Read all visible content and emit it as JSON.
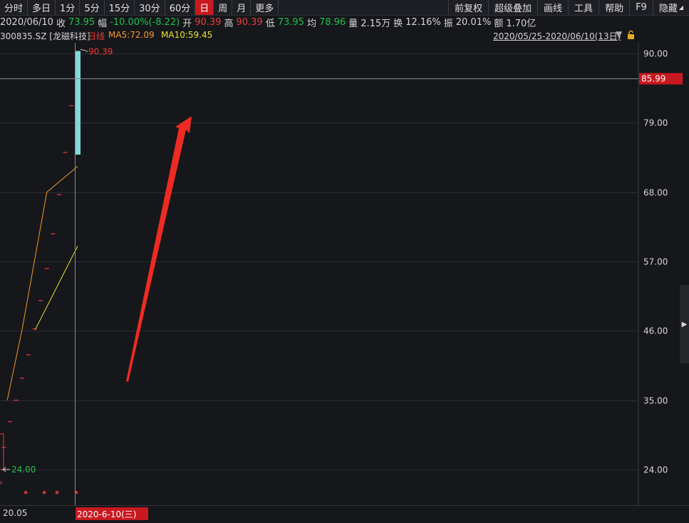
{
  "toolbar": {
    "left": [
      "分时",
      "多日",
      "1分",
      "5分",
      "15分",
      "30分",
      "60分",
      "日",
      "周",
      "月",
      "更多"
    ],
    "active": "日",
    "right": [
      "前复权",
      "超级叠加",
      "画线",
      "工具",
      "帮助",
      "F9",
      "隐藏"
    ]
  },
  "quote": {
    "date": "2020/06/10",
    "close_label": "收",
    "close": "73.95",
    "amp_label": "幅",
    "change_pct": "-10.00%",
    "change_val": "(-8.22)",
    "open_label": "开",
    "open": "90.39",
    "high_label": "高",
    "high": "90.39",
    "low_label": "低",
    "low": "73.95",
    "avg_label": "均",
    "avg": "78.96",
    "vol_label": "量",
    "vol": "2.15万",
    "turnover_label": "换",
    "turnover": "12.16%",
    "swing_label": "振",
    "swing": "20.01%",
    "amount_label": "额",
    "amount": "1.70亿"
  },
  "info": {
    "code": "300835.SZ [龙磁科技]",
    "period": "日线",
    "ma5": "MA5:72.09",
    "ma10": "MA10:59.45",
    "range": "2020/05/25-2020/06/10(13日)"
  },
  "colors": {
    "up": "#ef3a3a",
    "down": "#1fbf4e",
    "ma5": "#f29a2e",
    "ma10": "#e9e432",
    "candle_down_fill": "#7fd9dc",
    "badge": "#c7191f",
    "grid": "#2c2d33",
    "arrow": "#ee2b22"
  },
  "chart_data": {
    "type": "candlestick",
    "y_axis": {
      "ticks": [
        90.0,
        79.0,
        68.0,
        57.0,
        46.0,
        35.0,
        24.0
      ],
      "range": [
        24.0,
        90.0
      ]
    },
    "y_tick_labels": [
      "90.00",
      "79.00",
      "68.00",
      "57.00",
      "46.00",
      "35.00",
      "24.00"
    ],
    "crosshair_price": 85.99,
    "crosshair_label": "85.99",
    "high_label": "90.39",
    "low_label": "24.00",
    "x_labels": {
      "left": "20.05",
      "current": "2020-6-10(三)"
    },
    "candle_last": {
      "open": 90.39,
      "high": 90.39,
      "low": 73.95,
      "close": 73.95
    },
    "limit_up_dashes": [
      27.5,
      31.6,
      35.0,
      38.5,
      42.2,
      46.3,
      50.8,
      55.9,
      61.4,
      67.6,
      74.3,
      81.7,
      90.0
    ],
    "ma5": [
      [
        35.0,
        35.0
      ],
      [
        50.0,
        46.3
      ],
      [
        68.0,
        68.0
      ],
      [
        72.09,
        72.09
      ]
    ],
    "ma10": [
      [
        46.2,
        46.2
      ],
      [
        59.45,
        59.45
      ]
    ],
    "markers": [
      "★",
      "★",
      "★",
      "★"
    ]
  }
}
